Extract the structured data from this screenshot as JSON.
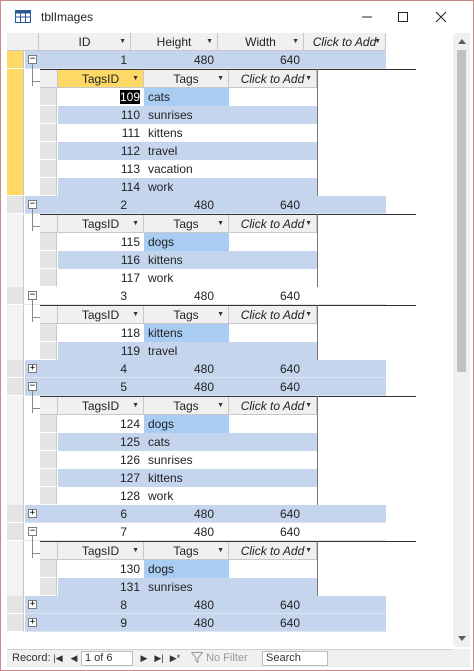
{
  "window": {
    "title": "tblImages"
  },
  "main_headers": {
    "id": "ID",
    "height": "Height",
    "width": "Width",
    "click_to_add": "Click to Add"
  },
  "sub_headers": {
    "tagsid": "TagsID",
    "tags": "Tags",
    "click_to_add": "Click to Add"
  },
  "records": [
    {
      "id": "1",
      "height": "480",
      "width": "640",
      "expanded": true,
      "tags": [
        {
          "tagsid": "109",
          "tag": "cats"
        },
        {
          "tagsid": "110",
          "tag": "sunrises"
        },
        {
          "tagsid": "111",
          "tag": "kittens"
        },
        {
          "tagsid": "112",
          "tag": "travel"
        },
        {
          "tagsid": "113",
          "tag": "vacation"
        },
        {
          "tagsid": "114",
          "tag": "work"
        }
      ]
    },
    {
      "id": "2",
      "height": "480",
      "width": "640",
      "expanded": true,
      "tags": [
        {
          "tagsid": "115",
          "tag": "dogs"
        },
        {
          "tagsid": "116",
          "tag": "kittens"
        },
        {
          "tagsid": "117",
          "tag": "work"
        }
      ]
    },
    {
      "id": "3",
      "height": "480",
      "width": "640",
      "expanded": true,
      "tags": [
        {
          "tagsid": "118",
          "tag": "kittens"
        },
        {
          "tagsid": "119",
          "tag": "travel"
        }
      ]
    },
    {
      "id": "4",
      "height": "480",
      "width": "640",
      "expanded": false,
      "tags": []
    },
    {
      "id": "5",
      "height": "480",
      "width": "640",
      "expanded": true,
      "tags": [
        {
          "tagsid": "124",
          "tag": "dogs"
        },
        {
          "tagsid": "125",
          "tag": "cats"
        },
        {
          "tagsid": "126",
          "tag": "sunrises"
        },
        {
          "tagsid": "127",
          "tag": "kittens"
        },
        {
          "tagsid": "128",
          "tag": "work"
        }
      ]
    },
    {
      "id": "6",
      "height": "480",
      "width": "640",
      "expanded": false,
      "tags": []
    },
    {
      "id": "7",
      "height": "480",
      "width": "640",
      "expanded": true,
      "tags": [
        {
          "tagsid": "130",
          "tag": "dogs"
        },
        {
          "tagsid": "131",
          "tag": "sunrises"
        }
      ]
    },
    {
      "id": "8",
      "height": "480",
      "width": "640",
      "expanded": false,
      "tags": []
    },
    {
      "id": "9",
      "height": "480",
      "width": "640",
      "expanded": false,
      "tags": []
    }
  ],
  "record_nav": {
    "label": "Record:",
    "current": "1 of 6",
    "filter_label": "No Filter",
    "search_placeholder": "Search"
  },
  "colors": {
    "current_record_selector": "#ffd966",
    "row_band_blue": "#c5d5ee",
    "tag_cell_highlight": "#a9ccf3",
    "window_border": "#c98a8a"
  }
}
